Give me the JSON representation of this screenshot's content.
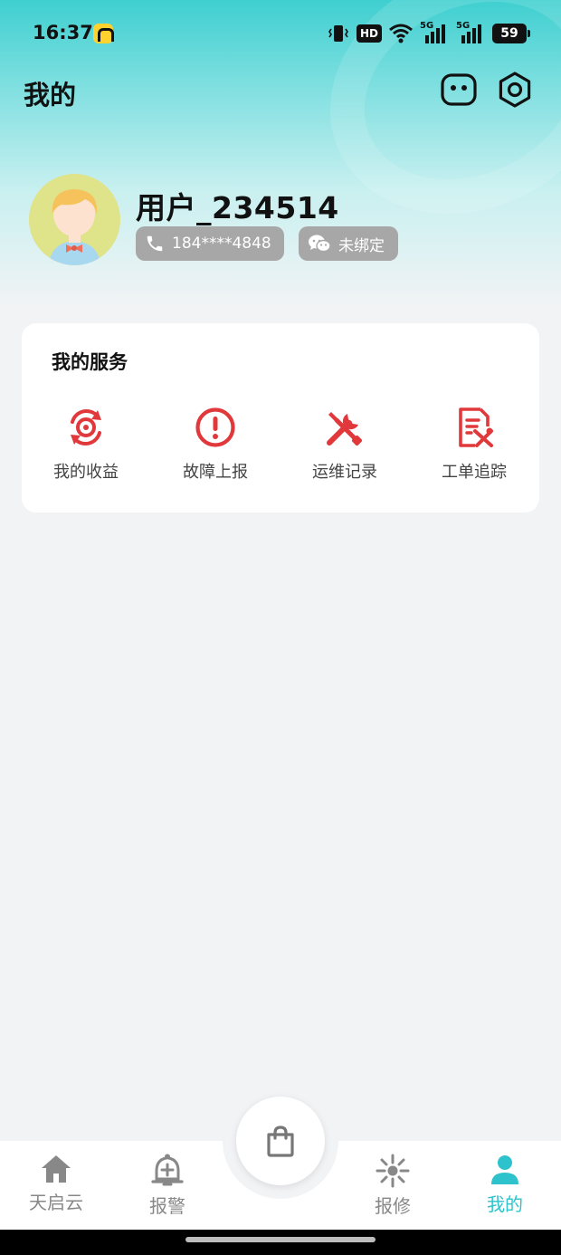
{
  "status_bar": {
    "time": "16:37",
    "hd_label": "HD",
    "signal_label_1": "5G",
    "signal_label_2": "5G",
    "battery": "59"
  },
  "header": {
    "title": "我的",
    "icons": [
      "robot-icon",
      "settings-gear-icon"
    ]
  },
  "profile": {
    "username": "用户_234514",
    "phone": "184****4848",
    "wechat_status": "未绑定"
  },
  "services": {
    "title": "我的服务",
    "items": [
      {
        "label": "我的收益",
        "icon": "earnings-refresh-icon"
      },
      {
        "label": "故障上报",
        "icon": "alert-circle-icon"
      },
      {
        "label": "运维记录",
        "icon": "tools-icon"
      },
      {
        "label": "工单追踪",
        "icon": "work-order-icon"
      }
    ],
    "accent_color": "#e0383b"
  },
  "bottom_nav": {
    "items": [
      {
        "label": "天启云",
        "icon": "home-icon",
        "active": false
      },
      {
        "label": "报警",
        "icon": "alarm-bell-icon",
        "active": false
      },
      {
        "label": "报修",
        "icon": "repair-icon",
        "active": false
      },
      {
        "label": "我的",
        "icon": "user-icon",
        "active": true
      }
    ],
    "center_icon": "shopping-bag-icon",
    "active_color": "#2ec3cc",
    "inactive_color": "#888888"
  }
}
